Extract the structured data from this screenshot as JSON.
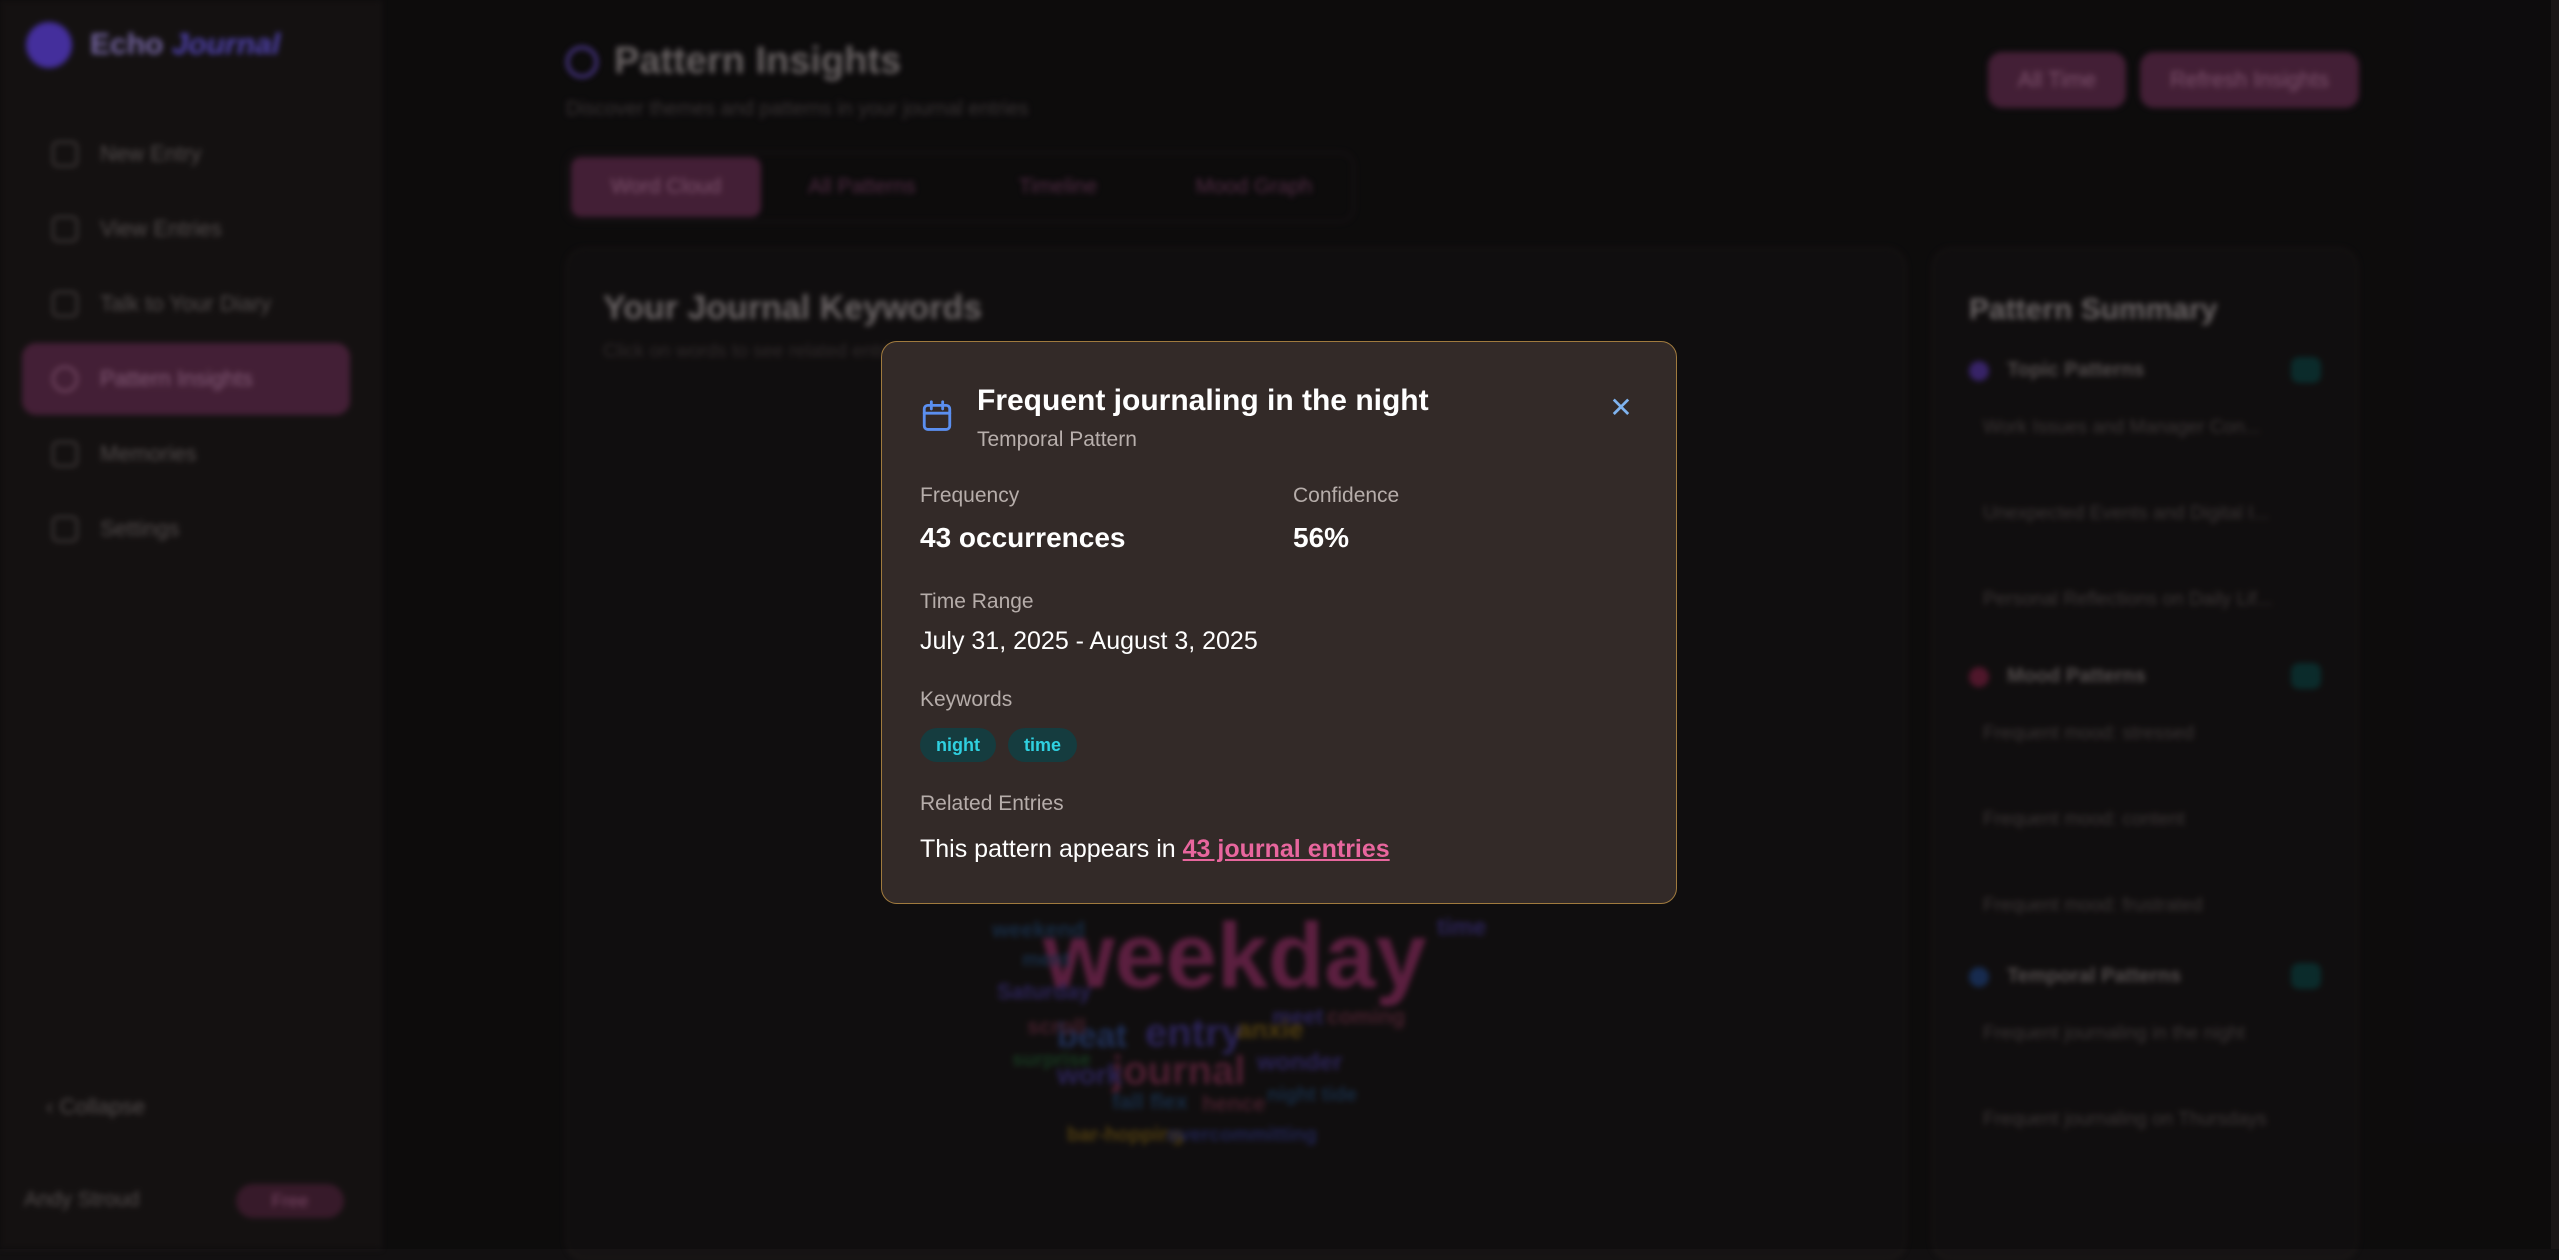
{
  "app": {
    "brand_main": "Echo",
    "brand_accent": "Journal",
    "nav": [
      {
        "label": "New Entry"
      },
      {
        "label": "View Entries"
      },
      {
        "label": "Talk to Your Diary"
      },
      {
        "label": "Pattern Insights"
      },
      {
        "label": "Memories"
      },
      {
        "label": "Settings"
      }
    ],
    "collapse_label": "Collapse",
    "user_name": "Andy Stroud",
    "user_badge": "Free"
  },
  "page": {
    "title": "Pattern Insights",
    "subtitle": "Discover themes and patterns in your journal entries",
    "actions": [
      {
        "label": "All Time"
      },
      {
        "label": "Refresh Insights"
      }
    ],
    "tabs": [
      {
        "label": "Word Cloud",
        "active": true
      },
      {
        "label": "All Patterns"
      },
      {
        "label": "Timeline"
      },
      {
        "label": "Mood Graph"
      }
    ],
    "keywords_card": {
      "title": "Your Journal Keywords",
      "subtitle": "Click on words to see related entries",
      "words": [
        {
          "text": "weekday",
          "color": "#7a2a55"
        },
        {
          "text": "journal",
          "color": "#6a2a44"
        },
        {
          "text": "entry",
          "color": "#3a2f74"
        },
        {
          "text": "beat",
          "color": "#2a3f74"
        },
        {
          "text": "work",
          "color": "#3a2f74"
        },
        {
          "text": "time",
          "color": "#3a2f74"
        },
        {
          "text": "Saturday",
          "color": "#3a2f74"
        },
        {
          "text": "scroll",
          "color": "#5a2a3a"
        },
        {
          "text": "surprise",
          "color": "#1f4a2a"
        },
        {
          "text": "ment",
          "color": "#1f3a5a"
        },
        {
          "text": "weekend",
          "color": "#1f3a5a"
        },
        {
          "text": "anxie",
          "color": "#6a5214"
        },
        {
          "text": "meet",
          "color": "#3a2f74"
        },
        {
          "text": "coming",
          "color": "#5a2a3a"
        },
        {
          "text": "wonder",
          "color": "#3a2f74"
        },
        {
          "text": "fall flex",
          "color": "#1f3a5a"
        },
        {
          "text": "hence",
          "color": "#5a2a3a"
        },
        {
          "text": "night tide",
          "color": "#1f3a5a"
        },
        {
          "text": "bar-hopping",
          "color": "#6a5214"
        },
        {
          "text": "overcommitting",
          "color": "#2a2f6a"
        }
      ]
    },
    "summary": {
      "title": "Pattern Summary",
      "groups": [
        {
          "label": "Topic Patterns",
          "color": "#4a2f8a",
          "items": [
            "Work Issues and Manager Con...",
            "Unexpected Events and Digital I...",
            "Personal Reflections on Daily Lif..."
          ]
        },
        {
          "label": "Mood Patterns",
          "color": "#6a1f3a",
          "items": [
            "Frequent mood: stressed",
            "Frequent mood: content",
            "Frequent mood: frustrated"
          ]
        },
        {
          "label": "Temporal Patterns",
          "color": "#1f3a6a",
          "items": [
            "Frequent journaling in the night",
            "Frequent journaling on Thursdays"
          ]
        }
      ]
    }
  },
  "modal": {
    "title": "Frequent journaling in the night",
    "subtitle": "Temporal Pattern",
    "frequency_label": "Frequency",
    "frequency_value": "43 occurrences",
    "confidence_label": "Confidence",
    "confidence_value": "56%",
    "time_range_label": "Time Range",
    "time_range_value": "July 31, 2025 - August 3, 2025",
    "keywords_label": "Keywords",
    "keywords": [
      "night",
      "time"
    ],
    "related_label": "Related Entries",
    "related_prefix": "This pattern appears in",
    "related_link": "43 journal entries",
    "icon": "calendar-icon",
    "close_icon": "close-icon",
    "accent_border": "#a07a3e",
    "link_color": "#e8669e"
  }
}
